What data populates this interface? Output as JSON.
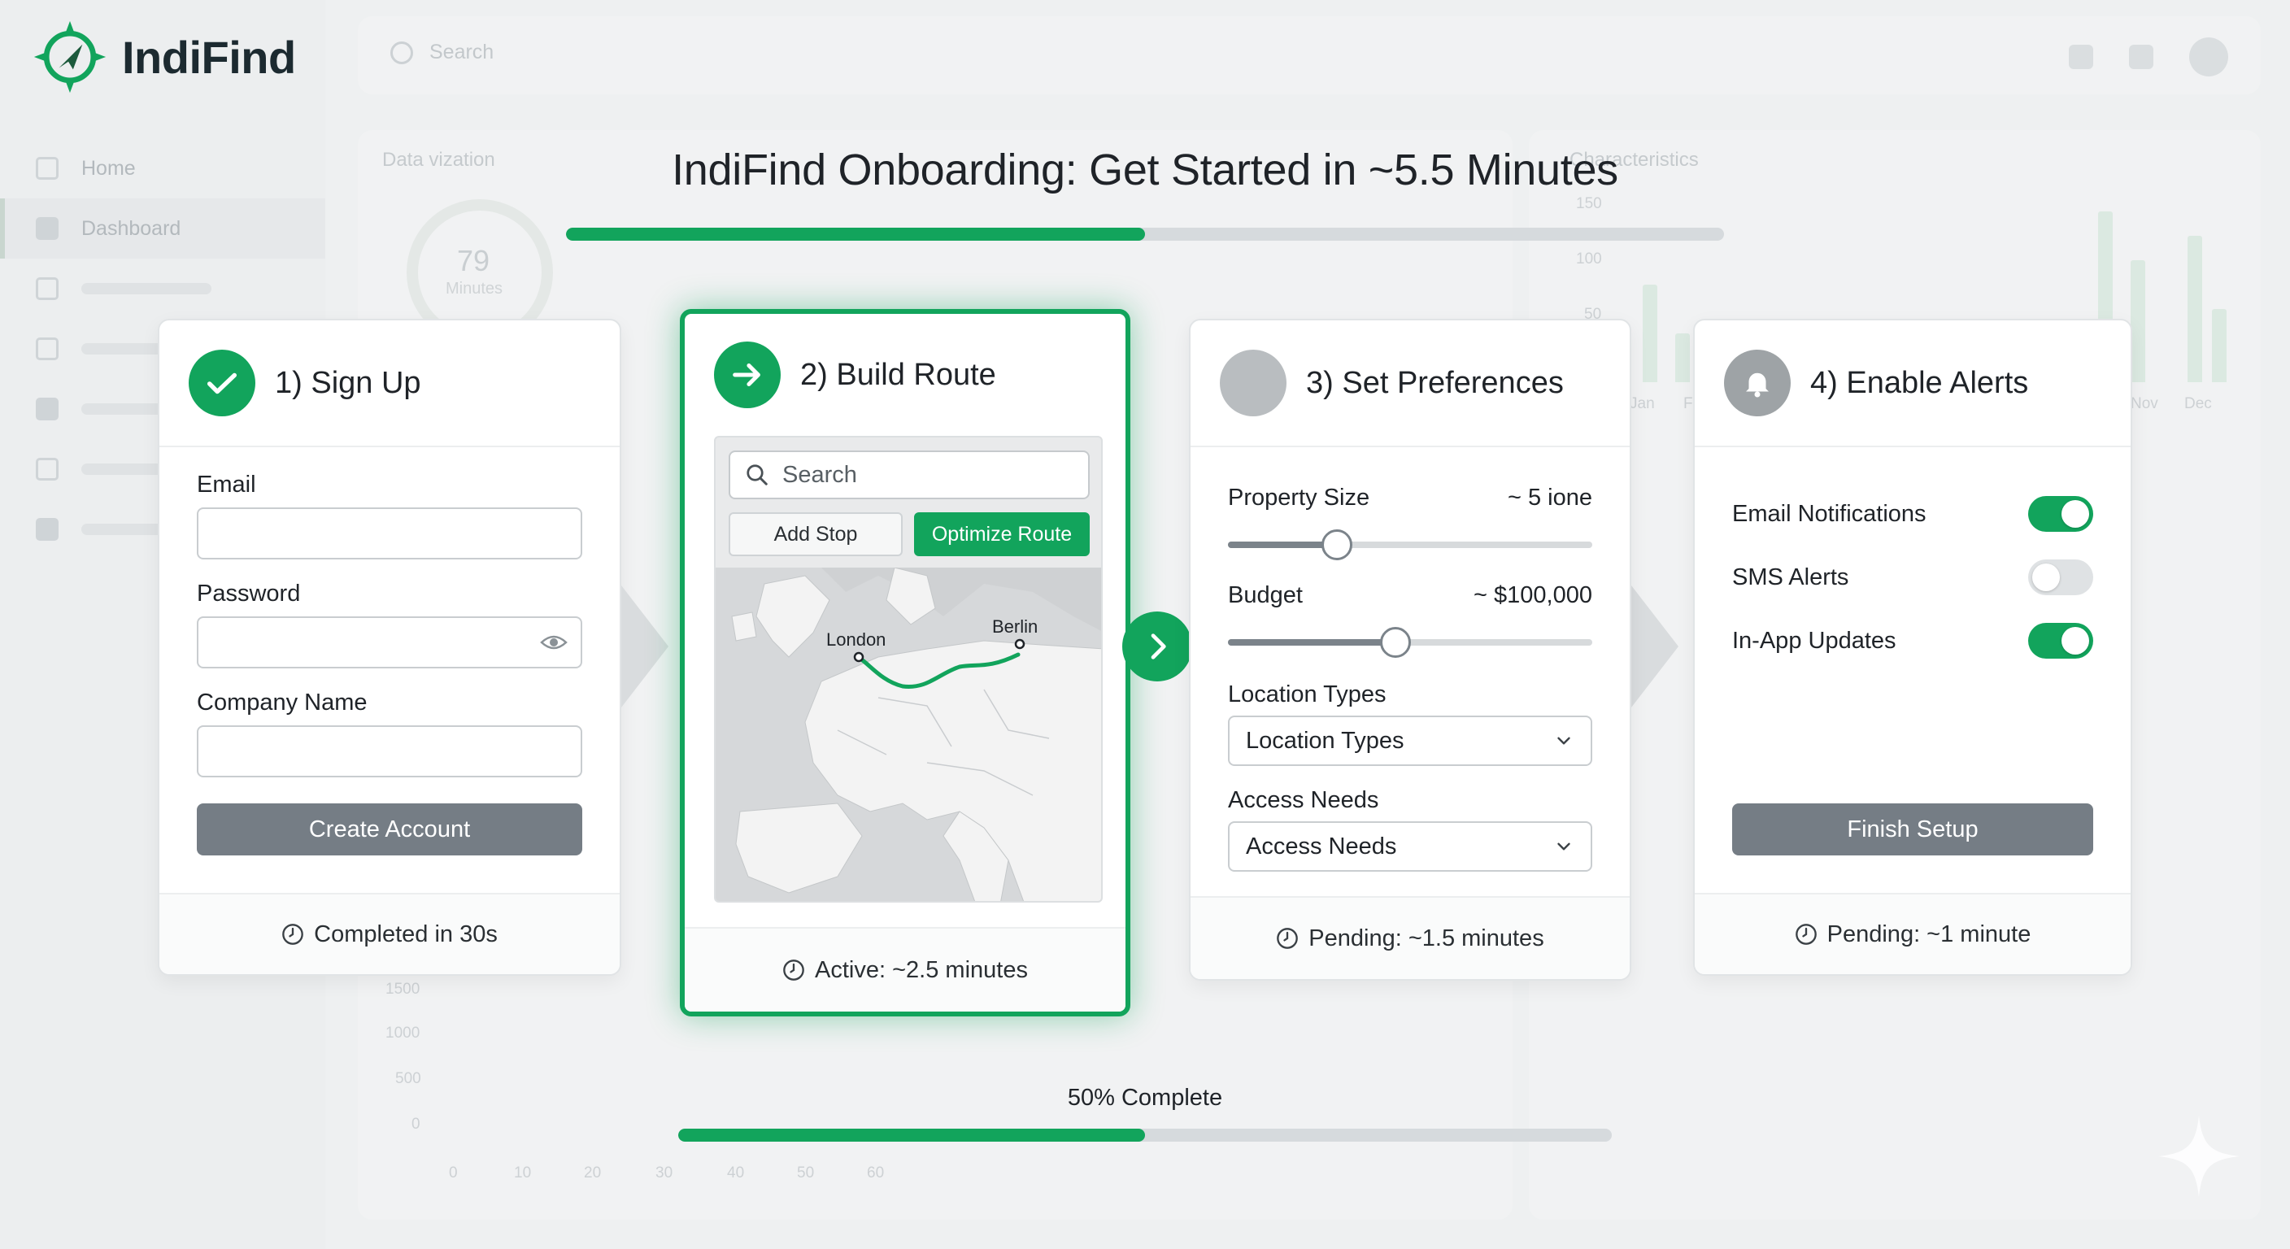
{
  "app": {
    "name": "IndiFind"
  },
  "background": {
    "search_placeholder": "Search",
    "nav": [
      {
        "label": "Home"
      },
      {
        "label": "Dashboard"
      }
    ],
    "panel_left_title": "Data vization",
    "panel_right_title": "Characteristics",
    "ring_value": "79",
    "ring_unit": "Minutes",
    "y_ticks": [
      "1500",
      "1000",
      "500",
      "0"
    ],
    "x_ticks": [
      "0",
      "10",
      "20",
      "30",
      "40",
      "50",
      "60"
    ],
    "right_y_ticks": [
      "150",
      "100",
      "50"
    ],
    "right_x_ticks": [
      "Jan",
      "F",
      "Nov",
      "Dec"
    ]
  },
  "onboarding": {
    "title": "IndiFind Onboarding: Get Started in ~5.5 Minutes",
    "progress_fraction": 0.5,
    "progress_label": "50% Complete"
  },
  "steps": {
    "signup": {
      "title": "1) Sign Up",
      "email_label": "Email",
      "password_label": "Password",
      "company_label": "Company Name",
      "button": "Create Account",
      "status": "Completed in 30s"
    },
    "route": {
      "title": "2) Build Route",
      "search_placeholder": "Search",
      "add_stop": "Add Stop",
      "optimize": "Optimize Route",
      "city_a": "London",
      "city_b": "Berlin",
      "status": "Active: ~2.5 minutes"
    },
    "prefs": {
      "title": "3) Set Preferences",
      "size_label": "Property Size",
      "size_value": "~ 5 ione",
      "size_fraction": 0.3,
      "budget_label": "Budget",
      "budget_value": "~ $100,000",
      "budget_fraction": 0.46,
      "location_label": "Location Types",
      "location_selected": "Location Types",
      "access_label": "Access Needs",
      "access_selected": "Access Needs",
      "status": "Pending: ~1.5 minutes"
    },
    "alerts": {
      "title": "4) Enable Alerts",
      "toggles": [
        {
          "label": "Email Notifications",
          "on": true
        },
        {
          "label": "SMS Alerts",
          "on": false
        },
        {
          "label": "In-App Updates",
          "on": true
        }
      ],
      "button": "Finish Setup",
      "status": "Pending: ~1 minute"
    }
  },
  "colors": {
    "accent": "#12a45c",
    "button_grey": "#757d85",
    "track": "#d6dadd"
  }
}
